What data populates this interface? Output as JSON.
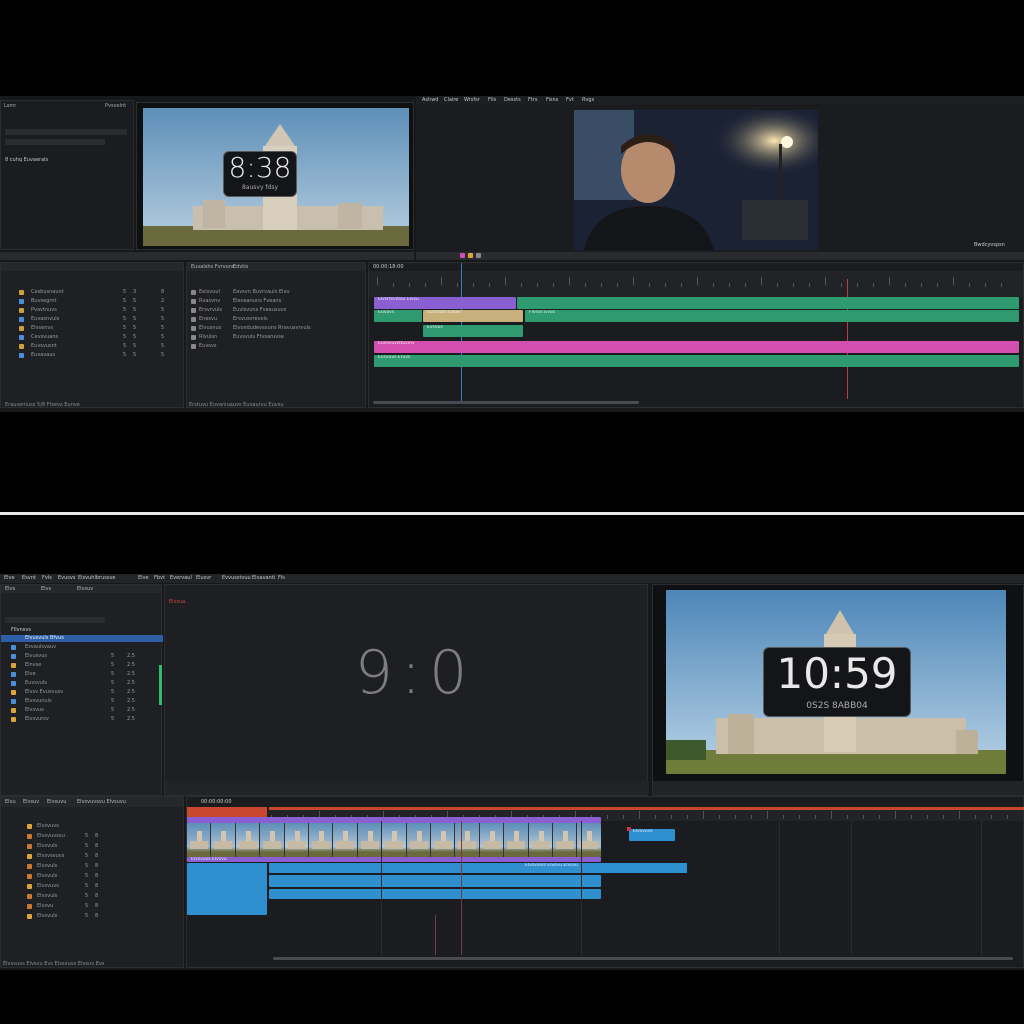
{
  "top": {
    "menu": [
      "Ashwd",
      "Claire",
      "Wrsfsr",
      "Flls",
      "Dessts",
      "Ftrs",
      "Fisns",
      "Fvt",
      "Rvgs"
    ],
    "left_panel": {
      "tabs": [
        "Lsmr",
        "Pvsvelnt"
      ],
      "header": "8 cuhq Euvaerals",
      "rows": [
        {
          "label": "Cesbusnaunt",
          "a": "5",
          "b": "3",
          "c": "8"
        },
        {
          "label": "Buvsegrnt",
          "a": "5",
          "b": "5",
          "c": "2"
        },
        {
          "label": "Pvavtnuvs",
          "a": "5",
          "b": "5",
          "c": "5"
        },
        {
          "label": "Euvasnvuls",
          "a": "5",
          "b": "5",
          "c": "5"
        },
        {
          "label": "Elvsenvs",
          "a": "5",
          "b": "5",
          "c": "5"
        },
        {
          "label": "Cevsvuans",
          "a": "5",
          "b": "5",
          "c": "5"
        },
        {
          "label": "Euvsvusnt",
          "a": "5",
          "b": "5",
          "c": "5"
        },
        {
          "label": "Euvavaus",
          "a": "5",
          "b": "5",
          "c": "5"
        }
      ],
      "footer": "Erausemuss 5/8 Ftsevs Eunve"
    },
    "media_panel": {
      "tabs": [
        "Euvalshs Fvrvuns",
        "Edvtis"
      ],
      "rows": [
        "Eeisvuul",
        "Rvasvnv",
        "Ersvrvuls",
        "Enesvu",
        "Elvusnus",
        "Rlvulsn",
        "Euvsvs"
      ],
      "details": [
        "Eavsvn Buvrvauls Elvu",
        "Eleveanuns Fveans",
        "Euvlsvuns Fveausuvs",
        "Ersvusvrevels",
        "Elvovdudevsvuns Rravusvrvuls",
        "Euvsvuls Ftvsaruvse"
      ],
      "footer": "Erstuvu Euvaniuauvs Euvaurvu Euvsu"
    },
    "source_clock": {
      "time": "8:38",
      "sub": "8ausvy fdsy"
    },
    "program_monitor": {
      "watermark": "Bwdcyvspsn"
    },
    "timeline": {
      "timecode": "00:00:18:00",
      "tracks": [
        {
          "clips": [
            {
              "label": "Elvsrtsvdiau Elvsu",
              "color": "#8a5fd1"
            },
            {
              "label": "",
              "color": "#2f9a70"
            }
          ]
        },
        {
          "clips": [
            {
              "label": "Euvavs",
              "color": "#2f9a70"
            },
            {
              "label": "Euvsruls Evsav",
              "color": "#c7b07b"
            },
            {
              "label": "Flvsvs Evus",
              "color": "#2f9a70"
            }
          ]
        },
        {
          "clips": [
            {
              "label": "Evsvus",
              "color": "#2f9a70"
            },
            {
              "label": "Ausiv Fvshvs",
              "color": "#e38a2e"
            }
          ]
        },
        {
          "clips": [
            {
              "label": "Euvsvuvlstuvinv",
              "color": "#d24fb0"
            }
          ]
        },
        {
          "clips": [
            {
              "label": "Evsvuvs Eruvs",
              "color": "#2f9a70"
            }
          ]
        }
      ]
    }
  },
  "bottom": {
    "menu": [
      "Elve",
      "Esvnt",
      "Fvls",
      "Evusvs",
      "Eisvuhlbrussve",
      "Elve",
      "Fbvt",
      "Evervaul",
      "Elusvr",
      "Evvusstvuu",
      "Elvavanti",
      "Fls"
    ],
    "project": {
      "tabs": [
        "Elvs",
        "Elvs",
        "Elvsuv"
      ],
      "header": "Fllvnsvs",
      "rows": [
        {
          "label": "Elvusvuls Bfvus",
          "a": "",
          "b": "",
          "color": "#2e5fa6"
        },
        {
          "label": "Esvaulsvauv",
          "a": "",
          "b": "",
          "color": "#4a8fd8"
        },
        {
          "label": "Elvusvus",
          "a": "5",
          "b": "2.5",
          "color": "#4a8fd8"
        },
        {
          "label": "Elnvse",
          "a": "5",
          "b": "2.5",
          "color": "#e0a23a"
        },
        {
          "label": "Elve",
          "a": "5",
          "b": "2.5",
          "color": "#4a8fd8"
        },
        {
          "label": "Euvsvuls",
          "a": "5",
          "b": "2.5",
          "color": "#4a8fd8"
        },
        {
          "label": "Elvsv Evusvusv",
          "a": "5",
          "b": "2.5",
          "color": "#e0a23a"
        },
        {
          "label": "Elvsvunuls",
          "a": "5",
          "b": "2.5",
          "color": "#4a8fd8"
        },
        {
          "label": "Elvsvus",
          "a": "5",
          "b": "2.5",
          "color": "#e0a23a"
        },
        {
          "label": "Elvsvursv",
          "a": "5",
          "b": "2.5",
          "color": "#e0a23a"
        }
      ]
    },
    "source_monitor": {
      "display": "9:0",
      "tag": "Elvsua"
    },
    "program_monitor": {
      "time": "10:59",
      "sub": "0S2S 8ABB04"
    },
    "tracks_panel": {
      "tabs": [
        "Elvu",
        "Elvsuv",
        "Elvsuvu",
        "Elvsvuvsvu Elvsuvu"
      ],
      "timecode": "00:00:00:00",
      "rows": [
        {
          "label": "Elvsvuvs",
          "a": "",
          "b": ""
        },
        {
          "label": "Elvsvuvsvu",
          "a": "5",
          "b": "8"
        },
        {
          "label": "Elvsvuls",
          "a": "5",
          "b": "8"
        },
        {
          "label": "Elvsvsvuvs",
          "a": "5",
          "b": "8"
        },
        {
          "label": "Elvsvuls",
          "a": "5",
          "b": "8"
        },
        {
          "label": "Elvsvuls",
          "a": "5",
          "b": "8"
        },
        {
          "label": "Elvsvuvs",
          "a": "5",
          "b": "8"
        },
        {
          "label": "Elvsvuls",
          "a": "5",
          "b": "8"
        },
        {
          "label": "Elvsvu",
          "a": "5",
          "b": "8"
        },
        {
          "label": "Elvsvuls",
          "a": "5",
          "b": "8"
        }
      ],
      "footer": "Elvsvuvs Elvsvu Evs Elvsvuvs Elvsuv Evs"
    },
    "timeline_clips": {
      "video_label": "Elvsvuvs Elvsvu",
      "audio_label": "Elvsvuvls Elvsvu Elvsvu",
      "small_clip": "Elvsvuvs"
    }
  }
}
